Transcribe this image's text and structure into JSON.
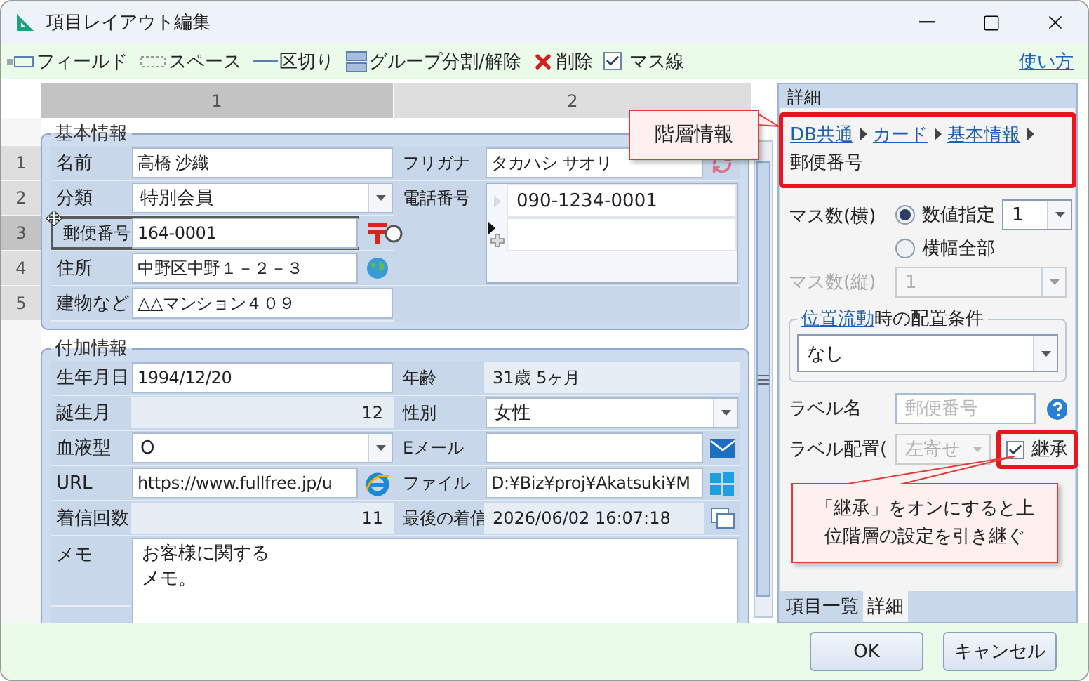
{
  "window": {
    "title": "項目レイアウト編集"
  },
  "toolbar": {
    "items": [
      {
        "kind": "field",
        "label": "フィールド"
      },
      {
        "kind": "space",
        "label": "スペース"
      },
      {
        "kind": "divider",
        "label": "区切り"
      },
      {
        "kind": "group",
        "label": "グループ分割/解除"
      },
      {
        "kind": "delete",
        "label": "削除"
      },
      {
        "kind": "check",
        "label": "マス線",
        "checked": true
      }
    ],
    "help_link": "使い方"
  },
  "grid": {
    "columns": [
      {
        "label": "1",
        "selected": true
      },
      {
        "label": "2",
        "selected": false
      }
    ],
    "rows": [
      {
        "label": "1",
        "selected": false
      },
      {
        "label": "2",
        "selected": false
      },
      {
        "label": "3",
        "selected": true
      },
      {
        "label": "4",
        "selected": false
      },
      {
        "label": "5",
        "selected": false
      }
    ]
  },
  "groups": [
    {
      "title": "基本情報",
      "rows": [
        {
          "left": {
            "label": "名前",
            "value": "高橋 沙織",
            "kind": "text",
            "selected": false
          },
          "right": {
            "label": "フリガナ",
            "value": "タカハシ サオリ",
            "kind": "text",
            "action": {
              "kind": "refresh"
            }
          }
        },
        {
          "left": {
            "label": "分類",
            "value": "特別会員",
            "kind": "combo",
            "selected": false
          },
          "right": {
            "label": "電話番号",
            "kind": "list",
            "values": [
              "090-1234-0001"
            ]
          }
        },
        {
          "left": {
            "label": "郵便番号",
            "value": "164-0001",
            "kind": "text",
            "action": {
              "kind": "postal"
            },
            "selected": true
          }
        },
        {
          "left": {
            "label": "住所",
            "value": "中野区中野１－２－３",
            "kind": "text",
            "action": {
              "kind": "globe"
            },
            "selected": false
          }
        },
        {
          "left": {
            "label": "建物など",
            "value": "△△マンション４０９",
            "kind": "text",
            "selected": false
          }
        }
      ]
    },
    {
      "title": "付加情報",
      "rows": [
        {
          "left": {
            "label": "生年月日",
            "value": "1994/12/20",
            "kind": "text"
          },
          "right": {
            "label": "年齢",
            "value": "31歳 5ヶ月",
            "kind": "readonly"
          }
        },
        {
          "left": {
            "label": "誕生月",
            "value": "12",
            "kind": "number"
          },
          "right": {
            "label": "性別",
            "value": "女性",
            "kind": "combo"
          }
        },
        {
          "left": {
            "label": "血液型",
            "value": "O",
            "kind": "combo"
          },
          "right": {
            "label": "Eメール",
            "kind": "text",
            "action": {
              "kind": "mail"
            }
          }
        },
        {
          "left": {
            "label": "URL",
            "value": "https://www.fullfree.jp/u",
            "kind": "text",
            "action": {
              "kind": "browser"
            }
          },
          "right": {
            "label": "ファイル",
            "value": "D:¥Biz¥proj¥Akatsuki¥M",
            "kind": "text",
            "action": {
              "kind": "windows"
            }
          }
        },
        {
          "left": {
            "label": "着信回数",
            "value": "11",
            "kind": "number"
          },
          "right": {
            "label": "最後の着信",
            "value": "2026/06/02 16:07:18",
            "kind": "readonly",
            "action": {
              "kind": "copy"
            }
          }
        },
        {
          "left": {
            "label": "メモ",
            "lines": [
              "お客様に関する",
              "メモ。"
            ],
            "kind": "memo"
          }
        }
      ]
    }
  ],
  "detail_panel": {
    "title": "詳細",
    "breadcrumb": [
      {
        "text": "DB共通",
        "link": true
      },
      {
        "text": "カード",
        "link": true
      },
      {
        "text": "基本情報",
        "link": true
      },
      {
        "text": "郵便番号",
        "link": false
      }
    ],
    "columns_h": {
      "label": "マス数(横)",
      "options": [
        {
          "label": "数値指定",
          "selected": true
        },
        {
          "label": "横幅全部",
          "selected": false
        }
      ],
      "value": "1"
    },
    "rows_v": {
      "label": "マス数(縦)",
      "value": "1",
      "disabled": true
    },
    "flow": {
      "title_link": "位置流動",
      "title_rest": "時の配置条件",
      "value": "なし"
    },
    "label_name": {
      "label": "ラベル名",
      "placeholder": "郵便番号"
    },
    "label_align": {
      "label": "ラベル配置(",
      "value": "左寄せ",
      "disabled": true,
      "inherit": {
        "label": "継承",
        "checked": true
      }
    },
    "tabs": [
      {
        "label": "項目一覧",
        "selected": false
      },
      {
        "label": "詳細",
        "selected": true
      }
    ]
  },
  "callouts": [
    {
      "text": "階層情報"
    },
    {
      "text": "「継承」をオンにすると上位階層の設定を引き継ぐ"
    }
  ],
  "buttons": [
    "OK",
    "キャンセル"
  ]
}
